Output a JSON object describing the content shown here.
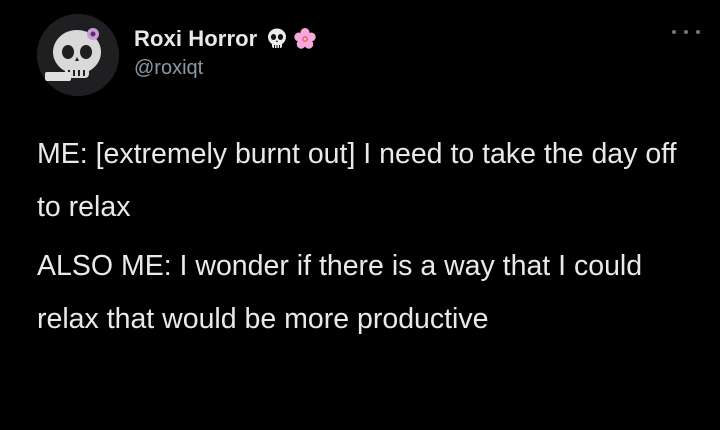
{
  "tweet": {
    "author": {
      "display_name": "Roxi Horror",
      "handle": "@roxiqt",
      "avatar_icon": "skull-avatar-icon",
      "name_emojis": [
        "skull-emoji-icon",
        "cherry-blossom-emoji-icon"
      ]
    },
    "menu_icon": "more-options-icon",
    "paragraphs": [
      "ME: [extremely burnt out] I need to take the day off to relax",
      "ALSO ME: I wonder if there is a way that I could relax that would be more productive"
    ]
  },
  "colors": {
    "background": "#000000",
    "text_primary": "#e7e9ea",
    "text_secondary": "#8b98a5",
    "accent_pink": "#f7a8d8"
  }
}
